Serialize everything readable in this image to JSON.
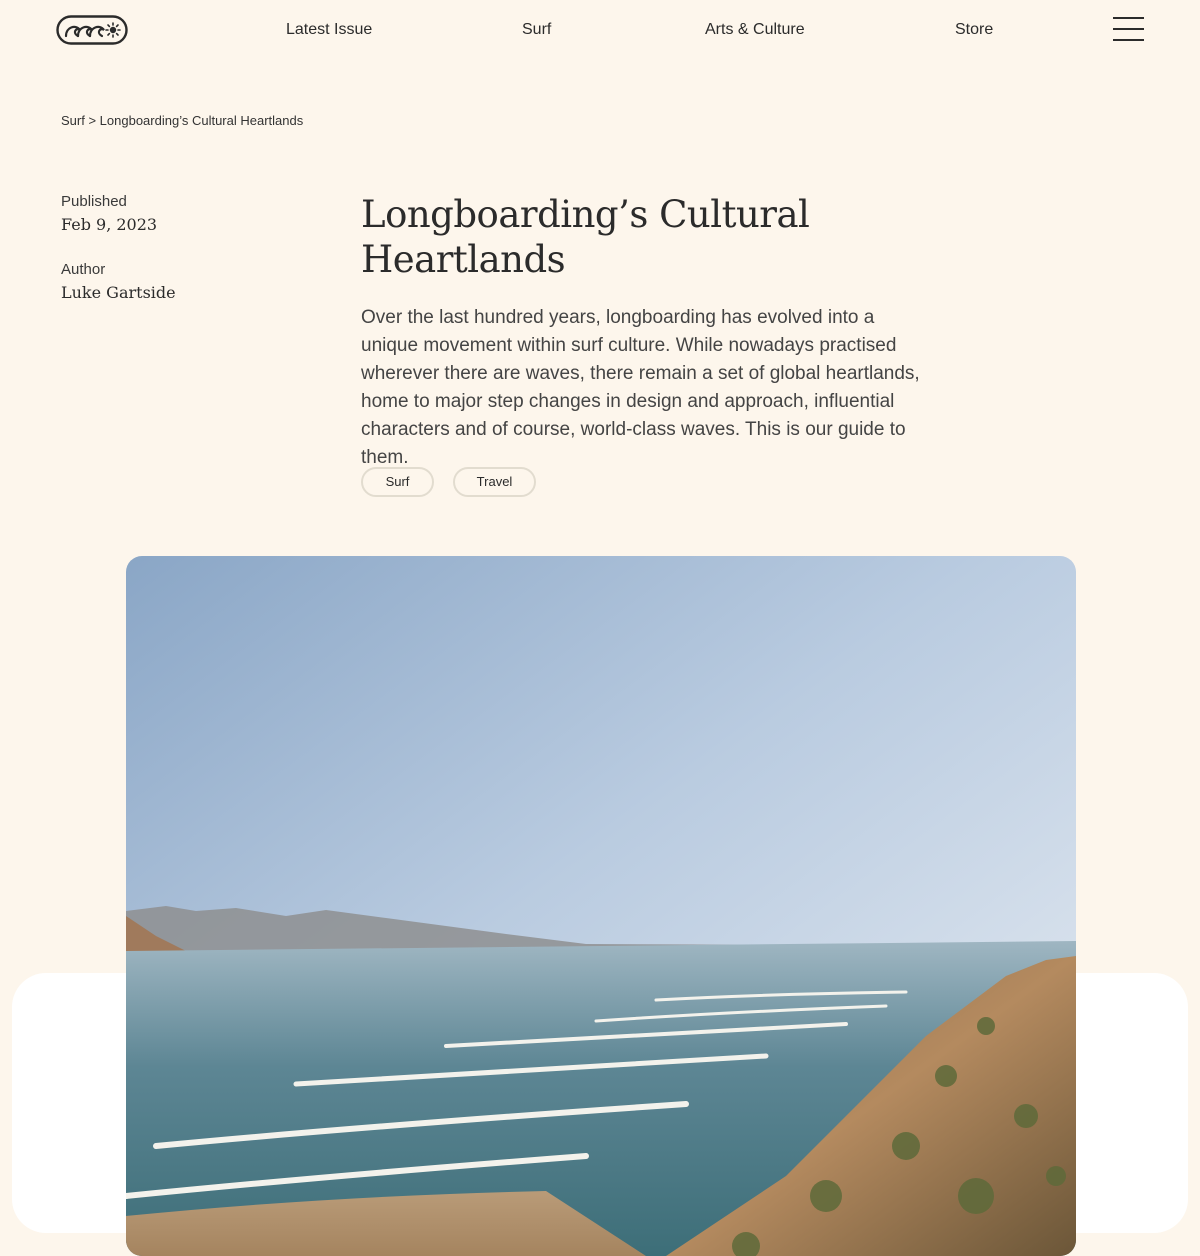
{
  "header": {
    "logo_icon": "wave-sun-logo-icon",
    "nav": [
      "Latest Issue",
      "Surf",
      "Arts & Culture",
      "Store"
    ],
    "menu_icon": "hamburger-menu-icon"
  },
  "breadcrumb": {
    "section": "Surf",
    "separator": " > ",
    "current": "Longboarding’s Cultural Heartlands"
  },
  "meta": {
    "published_label": "Published",
    "published_value": "Feb 9, 2023",
    "author_label": "Author",
    "author_value": "Luke Gartside"
  },
  "article": {
    "title": "Longboarding’s Cultural Heartlands",
    "intro": "Over the last hundred years, longboarding has evolved into a unique movement within surf culture. While nowadays practised wherever there are waves, there remain a set of global heartlands, home to major step changes in design and approach, influential characters and of course, world-class waves. This is our guide to them.",
    "tags": [
      "Surf",
      "Travel"
    ]
  },
  "colors": {
    "background": "#fdf6ec",
    "text": "#2b2b2b",
    "tag_border": "#e2dccf",
    "card": "#ffffff"
  }
}
